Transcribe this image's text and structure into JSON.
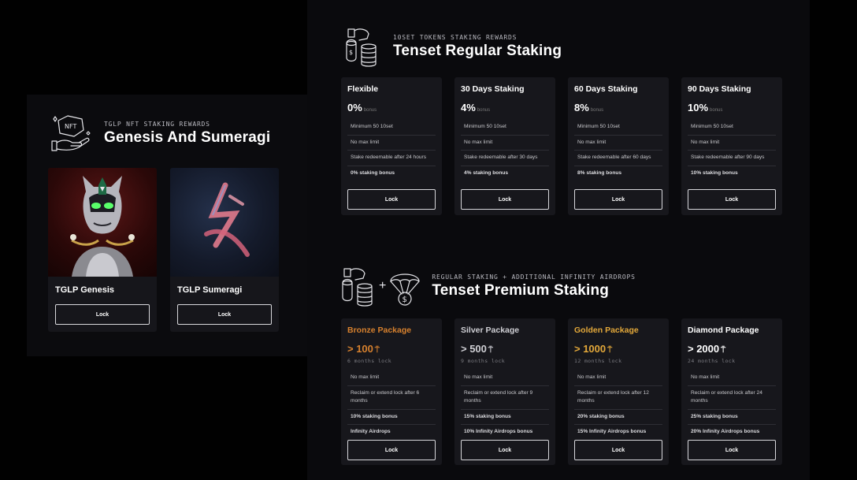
{
  "nft_section": {
    "subtitle": "TGLP NFT STAKING REWARDS",
    "title": "Genesis And Sumeragi",
    "cards": [
      {
        "name": "TGLP Genesis",
        "button": "Lock"
      },
      {
        "name": "TGLP Sumeragi",
        "button": "Lock"
      }
    ]
  },
  "regular": {
    "subtitle": "10SET TOKENS STAKING REWARDS",
    "title": "Tenset Regular Staking",
    "cards": [
      {
        "title": "Flexible",
        "pct": "0%",
        "bonus": "bonus",
        "features": [
          "Minimum 50 10set",
          "No max limit",
          "Stake redeemable after 24 hours",
          "0% staking bonus"
        ],
        "button": "Lock"
      },
      {
        "title": "30 Days Staking",
        "pct": "4%",
        "bonus": "bonus",
        "features": [
          "Minimum 50 10set",
          "No max limit",
          "Stake redeemable after 30 days",
          "4% staking bonus"
        ],
        "button": "Lock"
      },
      {
        "title": "60 Days Staking",
        "pct": "8%",
        "bonus": "bonus",
        "features": [
          "Minimum 50 10set",
          "No max limit",
          "Stake redeemable after 60 days",
          "8% staking bonus"
        ],
        "button": "Lock"
      },
      {
        "title": "90 Days Staking",
        "pct": "10%",
        "bonus": "bonus",
        "features": [
          "Minimum 50 10set",
          "No max limit",
          "Stake redeemable after 90 days",
          "10% staking bonus"
        ],
        "button": "Lock"
      }
    ]
  },
  "premium": {
    "subtitle": "REGULAR STAKING + ADDITIONAL INFINITY AIRDROPS",
    "title": "Tenset Premium Staking",
    "plus": "+",
    "cards": [
      {
        "title": "Bronze Package",
        "amount": "> 100",
        "lock": "6 months lock",
        "color": "#d7812e",
        "features": [
          "No max limit",
          "Reclaim or extend lock after 6 months",
          "10% staking bonus",
          "Infinity Airdrops"
        ],
        "button": "Lock"
      },
      {
        "title": "Silver Package",
        "amount": "> 500",
        "lock": "9 months lock",
        "color": "#cfcfd4",
        "features": [
          "No max limit",
          "Reclaim or extend lock after 9 months",
          "15% staking bonus",
          "10% Infinity Airdrops bonus"
        ],
        "button": "Lock"
      },
      {
        "title": "Golden Package",
        "amount": "> 1000",
        "lock": "12 months lock",
        "color": "#e3a83a",
        "features": [
          "No max limit",
          "Reclaim or extend lock after 12 months",
          "20% staking bonus",
          "15% Infinity Airdrops bonus"
        ],
        "button": "Lock"
      },
      {
        "title": "Diamond Package",
        "amount": "> 2000",
        "lock": "24 months lock",
        "color": "#ffffff",
        "features": [
          "No max limit",
          "Reclaim or extend lock after 24 months",
          "25% staking bonus",
          "20% Infinity Airdrops bonus"
        ],
        "button": "Lock"
      }
    ]
  },
  "icons": {
    "nft": "nft-hand-icon",
    "coins": "hand-coins-icon",
    "parachute": "parachute-dollar-icon",
    "token": "tenset-token-icon"
  }
}
